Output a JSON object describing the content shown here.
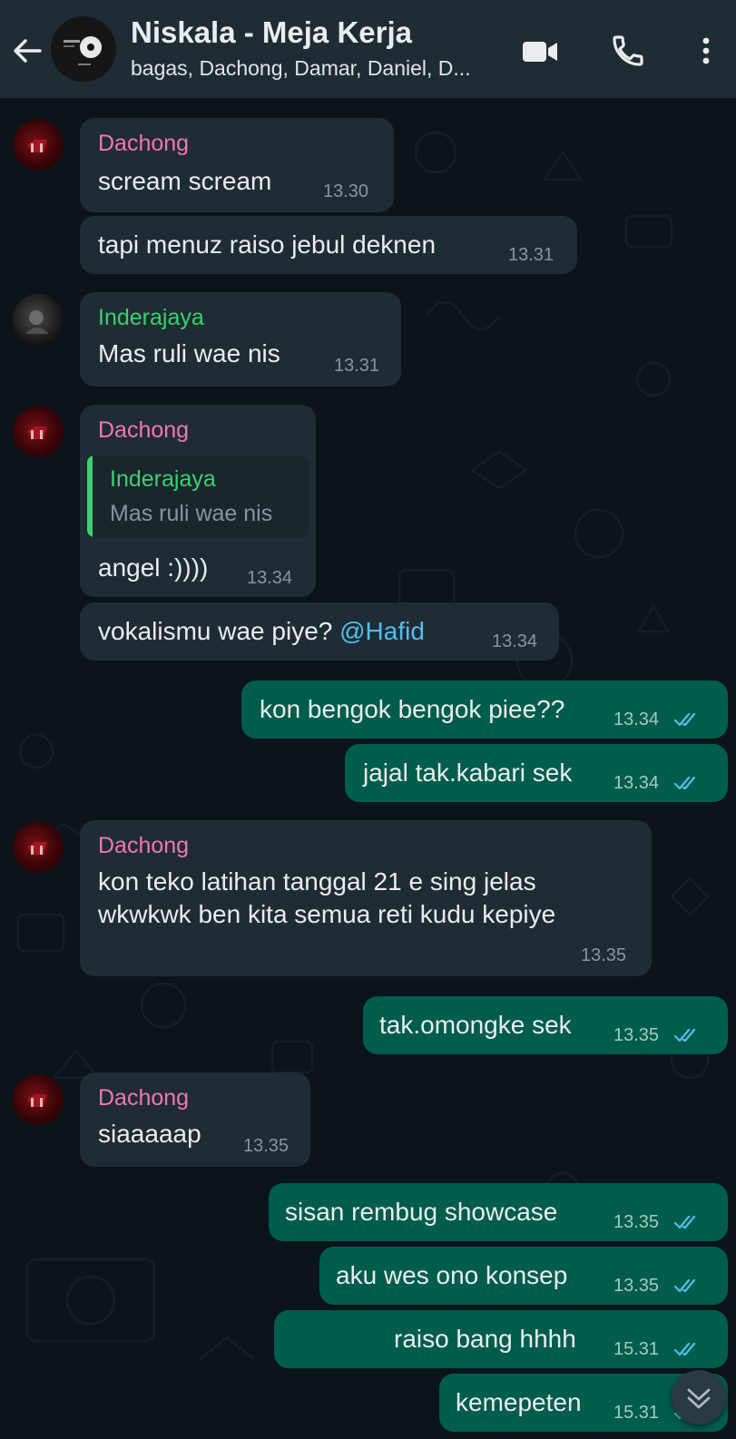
{
  "header": {
    "title": "Niskala - Meja Kerja",
    "subtitle": "bagas, Dachong, Damar, Daniel, D..."
  },
  "messages": [
    {
      "sender": "Dachong",
      "text": "scream scream",
      "time": "13.30"
    },
    {
      "text": "tapi menuz raiso jebul deknen",
      "time": "13.31"
    },
    {
      "sender": "Inderajaya",
      "text": "Mas ruli wae nis",
      "time": "13.31"
    },
    {
      "sender": "Dachong",
      "quote_sender": "Inderajaya",
      "quote_text": "Mas ruli wae nis",
      "text": "angel :))))",
      "time": "13.34"
    },
    {
      "text": "vokalismu wae piye?",
      "mention": "@Hafid",
      "time": "13.34"
    },
    {
      "text": "kon bengok bengok piee??",
      "time": "13.34",
      "status": "read"
    },
    {
      "text": "jajal tak.kabari sek",
      "time": "13.34",
      "status": "read"
    },
    {
      "sender": "Dachong",
      "text_line1": "kon teko latihan tanggal 21 e sing jelas",
      "text_line2": "wkwkwk ben kita semua reti kudu kepiye",
      "time": "13.35"
    },
    {
      "text": "tak.omongke sek",
      "time": "13.35",
      "status": "read"
    },
    {
      "sender": "Dachong",
      "text": "siaaaaap",
      "time": "13.35"
    },
    {
      "text": "sisan rembug showcase",
      "time": "13.35",
      "status": "read"
    },
    {
      "text": "aku wes ono konsep",
      "time": "13.35",
      "status": "read"
    },
    {
      "text": "raiso bang hhhh",
      "time": "15.31",
      "status": "read"
    },
    {
      "text": "kemepeten",
      "time": "15.31",
      "status": "read"
    }
  ],
  "colors": {
    "background": "#0b141a",
    "header": "#1f2c34",
    "incoming_bubble": "#1f2c34",
    "outgoing_bubble": "#005c4b",
    "sender_dachong": "#f177b0",
    "sender_inderajaya": "#3bd16f",
    "tick_read": "#53bdeb"
  },
  "icons": [
    "back-arrow-icon",
    "video-call-icon",
    "voice-call-icon",
    "more-options-icon",
    "double-check-icon",
    "chevron-down-icon"
  ]
}
